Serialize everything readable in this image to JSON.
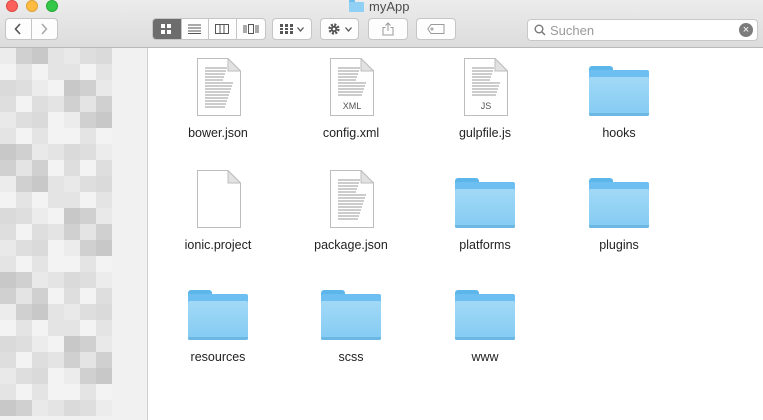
{
  "window": {
    "title": "myApp"
  },
  "toolbar": {
    "back_icon": "chevron-left-icon",
    "forward_icon": "chevron-right-icon",
    "view_modes": [
      "icon-view-icon",
      "list-view-icon",
      "column-view-icon",
      "cover-flow-icon"
    ],
    "active_view": "icon-view-icon",
    "arrange_icon": "arrange-grid-icon",
    "action_icon": "gear-icon",
    "share_icon": "share-icon",
    "tag_icon": "tag-icon"
  },
  "search": {
    "placeholder": "Suchen",
    "value": ""
  },
  "files": [
    {
      "name": "bower.json",
      "kind": "document",
      "ext": ""
    },
    {
      "name": "config.xml",
      "kind": "document",
      "ext": "XML"
    },
    {
      "name": "gulpfile.js",
      "kind": "document",
      "ext": "JS"
    },
    {
      "name": "hooks",
      "kind": "folder",
      "ext": ""
    },
    {
      "name": "ionic.project",
      "kind": "blank",
      "ext": ""
    },
    {
      "name": "package.json",
      "kind": "document",
      "ext": ""
    },
    {
      "name": "platforms",
      "kind": "folder",
      "ext": ""
    },
    {
      "name": "plugins",
      "kind": "folder",
      "ext": ""
    },
    {
      "name": "resources",
      "kind": "folder",
      "ext": ""
    },
    {
      "name": "scss",
      "kind": "folder",
      "ext": ""
    },
    {
      "name": "www",
      "kind": "folder",
      "ext": ""
    }
  ],
  "colors": {
    "folder": "#84cbf3",
    "active_segment": "#6d6d6d"
  }
}
